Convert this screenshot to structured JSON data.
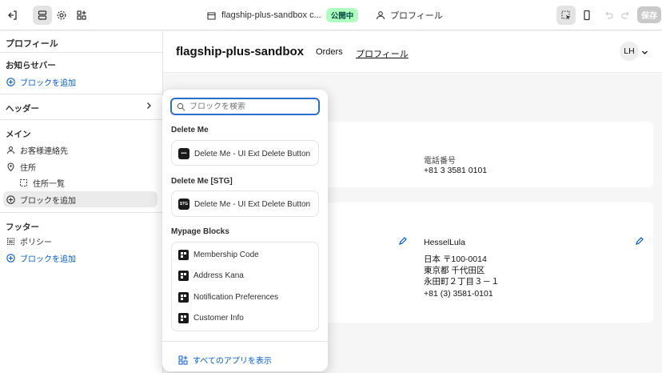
{
  "topbar": {
    "title": "flagship-plus-sandbox c...",
    "status_badge": "公開中",
    "template": "プロフィール",
    "save_label": "保存"
  },
  "sidebar": {
    "title": "プロフィール",
    "sections": {
      "announcement": "お知らせバー",
      "header": "ヘッダー",
      "main": "メイン",
      "footer": "フッター"
    },
    "add_block": "ブロックを追加",
    "items": {
      "customer_contact": "お客様連絡先",
      "address": "住所",
      "address_list": "住所一覧",
      "policy": "ポリシー"
    }
  },
  "preview": {
    "store_name": "flagship-plus-sandbox",
    "nav": {
      "orders": "Orders",
      "profile": "プロフィール"
    },
    "avatar_initials": "LH",
    "phone_label": "電話番号",
    "phone_value": "+81 3 3581 0101",
    "address_name": "HesselLula",
    "address_lines": [
      "日本 〒100-0014",
      "東京都 千代田区",
      "永田町２丁目３－１",
      "+81 (3) 3581-0101"
    ]
  },
  "popover": {
    "search_placeholder": "ブロックを検索",
    "groups": [
      {
        "title": "Delete Me",
        "items": [
          {
            "label": "Delete Me - UI Ext Delete Button",
            "icon": "dots-icon"
          }
        ]
      },
      {
        "title": "Delete Me [STG]",
        "items": [
          {
            "label": "Delete Me - UI Ext Delete Button",
            "icon": "stg-icon",
            "icon_text": "STG"
          }
        ]
      },
      {
        "title": "Mypage Blocks",
        "items": [
          {
            "label": "Membership Code"
          },
          {
            "label": "Address Kana"
          },
          {
            "label": "Notification Preferences"
          },
          {
            "label": "Customer Info"
          }
        ]
      }
    ],
    "show_all_apps": "すべてのアプリを表示"
  },
  "colors": {
    "accent": "#005bd3",
    "badge_bg": "#affebf",
    "focus": "#2c6ecb"
  }
}
